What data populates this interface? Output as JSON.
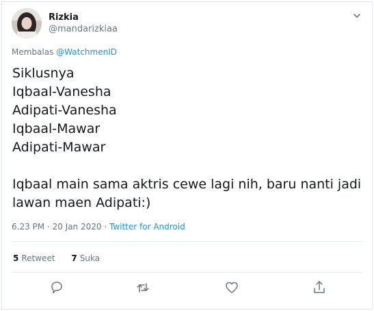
{
  "tweet": {
    "author": {
      "name": "Rizkia",
      "handle": "@mandarizkiaa"
    },
    "reply": {
      "prefix": "Membalas",
      "mention": "@WatchmenID"
    },
    "body": "Siklusnya\nIqbaal-Vanesha\nAdipati-Vanesha\nIqbaal-Mawar\nAdipati-Mawar\n\nIqbaal main sama aktris cewe lagi nih, baru nanti jadi lawan maen Adipati:)",
    "timestamp": "6.23 PM · 20 Jan 2020",
    "separator": " · ",
    "source": "Twitter for Android",
    "stats": {
      "retweets_count": "5",
      "retweets_label": "Retweet",
      "likes_count": "7",
      "likes_label": "Suka"
    }
  },
  "icons": {
    "caret": "chevron-down-icon",
    "reply": "reply-icon",
    "retweet": "retweet-icon",
    "like": "heart-icon",
    "share": "share-icon"
  },
  "colors": {
    "text": "#14171a",
    "secondary": "#657786",
    "link": "#1b95e0",
    "border": "#e1e8ed"
  }
}
